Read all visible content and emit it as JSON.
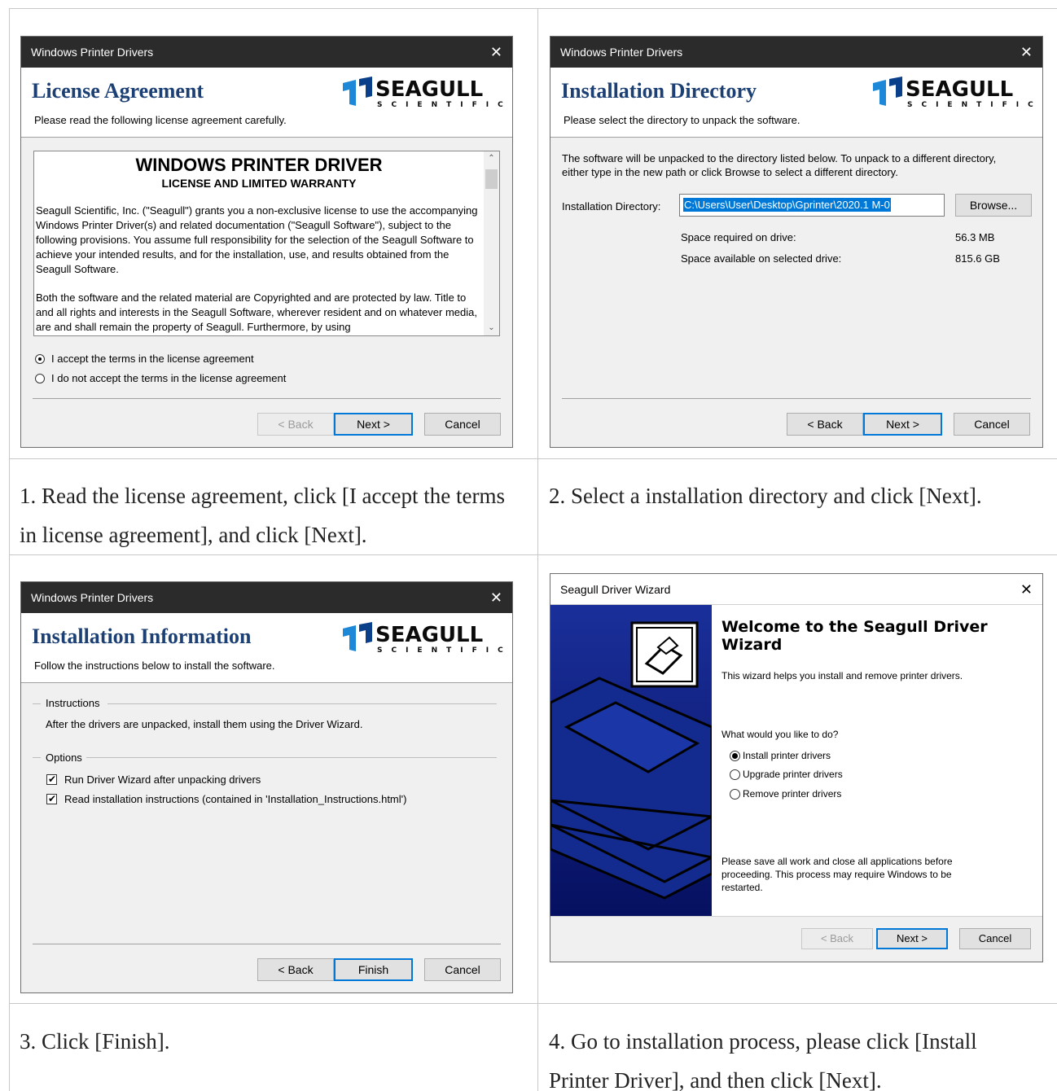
{
  "panel1": {
    "window_title": "Windows Printer Drivers",
    "close_glyph": "✕",
    "header_title": "License Agreement",
    "header_subtitle": "Please read the following license agreement carefully.",
    "logo_text": "SEAGULL",
    "logo_sub": "SCIENTIFIC",
    "license_title": "WINDOWS PRINTER DRIVER",
    "license_subtitle": "LICENSE AND LIMITED WARRANTY",
    "license_p1": "Seagull Scientific, Inc. (\"Seagull\") grants you a non-exclusive license to use the accompanying Windows Printer Driver(s) and related documentation (\"Seagull Software\"), subject to the following provisions.  You assume full responsibility for the selection of the Seagull Software to achieve your intended results, and for the installation, use, and results obtained from the Seagull Software.",
    "license_p2": "Both the software and the related material are Copyrighted and are protected by law. Title to and all rights and interests in the Seagull Software, wherever resident and on whatever media, are and shall remain the property of Seagull. Furthermore, by using",
    "radio_accept": "I accept the terms in the license agreement",
    "radio_decline": "I do not accept the terms in the license agreement",
    "back": "< Back",
    "next": "Next >",
    "cancel": "Cancel",
    "scroll_up": "⌃",
    "scroll_down": "⌄"
  },
  "panel2": {
    "window_title": "Windows Printer Drivers",
    "close_glyph": "✕",
    "header_title": "Installation Directory",
    "header_subtitle": "Please select the directory to unpack the software.",
    "logo_text": "SEAGULL",
    "logo_sub": "SCIENTIFIC",
    "desc_line1": "The software will be unpacked to the directory listed below.  To unpack to a different directory,",
    "desc_line2": "either type in the new path or click Browse to select a different directory.",
    "dir_label": "Installation Directory:",
    "dir_value": "C:\\Users\\User\\Desktop\\Gprinter\\2020.1 M-0",
    "browse": "Browse...",
    "space_required_label": "Space required on drive:",
    "space_required_value": "56.3 MB",
    "space_available_label": "Space available on selected drive:",
    "space_available_value": "815.6 GB",
    "back": "< Back",
    "next": "Next >",
    "cancel": "Cancel"
  },
  "panel3": {
    "window_title": "Windows Printer Drivers",
    "close_glyph": "✕",
    "header_title": "Installation Information",
    "header_subtitle": "Follow the instructions below to install the software.",
    "logo_text": "SEAGULL",
    "logo_sub": "SCIENTIFIC",
    "group_instructions": "Instructions",
    "instructions_text": "After the drivers are unpacked, install them using the Driver Wizard.",
    "group_options": "Options",
    "check1": "Run Driver Wizard after unpacking drivers",
    "check2": "Read installation instructions (contained in 'Installation_Instructions.html')",
    "check_glyph": "✔",
    "back": "< Back",
    "finish": "Finish",
    "cancel": "Cancel"
  },
  "panel4": {
    "window_title": "Seagull Driver Wizard",
    "close_glyph": "✕",
    "welcome_line1": "Welcome to the Seagull Driver",
    "welcome_line2": "Wizard",
    "intro": "This wizard helps you install and remove printer drivers.",
    "question": "What would you like to do?",
    "opt_install": "Install printer drivers",
    "opt_upgrade": "Upgrade printer drivers",
    "opt_remove": "Remove printer drivers",
    "note_line1": "Please save all work and close all applications before",
    "note_line2": "proceeding.  This process may require Windows to be",
    "note_line3": "restarted.",
    "back": "< Back",
    "next": "Next >",
    "cancel": "Cancel"
  },
  "captions": {
    "c1_line1": "1. Read the license agreement, click [I accept the terms",
    "c1_line2": "in license agreement], and click [Next].",
    "c2": "2. Select a installation directory and click [Next].",
    "c3": "3. Click [Finish].",
    "c4_line1": "4. Go to installation process, please click [Install",
    "c4_line2": "Printer Driver], and then click [Next]."
  },
  "colors": {
    "header_title": "#1c3f74",
    "titlebar": "#2b2b2b",
    "accent": "#0078d7",
    "wizard_left": "#0b1e7a"
  }
}
